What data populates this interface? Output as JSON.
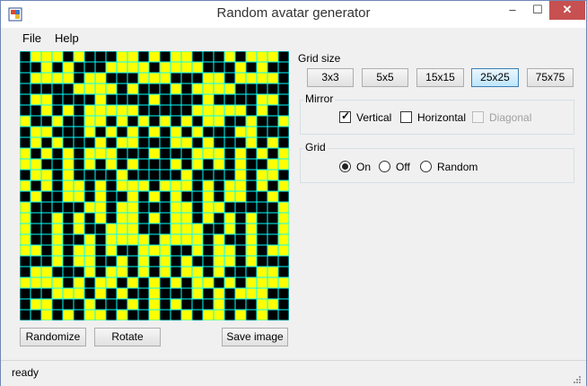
{
  "window": {
    "title": "Random avatar generator",
    "minimize_glyph": "–",
    "maximize_glyph": "☐",
    "close_glyph": "✕"
  },
  "menu": {
    "file": "File",
    "help": "Help"
  },
  "colors": {
    "foreground": "#000000",
    "background": "#ffff00",
    "gridline": "#00ffff"
  },
  "grid_size": {
    "label": "Grid size",
    "options": [
      "3x3",
      "5x5",
      "15x15",
      "25x25",
      "75x75"
    ],
    "selected": "25x25"
  },
  "mirror": {
    "label": "Mirror",
    "vertical": {
      "label": "Vertical",
      "checked": true
    },
    "horizontal": {
      "label": "Horizontal",
      "checked": false
    },
    "diagonal": {
      "label": "Diagonal",
      "checked": false,
      "disabled": true
    }
  },
  "grid": {
    "label": "Grid",
    "options": [
      "On",
      "Off",
      "Random"
    ],
    "selected": "On"
  },
  "buttons": {
    "randomize": "Randomize",
    "rotate": "Rotate",
    "save": "Save image"
  },
  "status": "ready",
  "avatar": {
    "size": 25,
    "rows": [
      "1000101110010100111010001",
      "1101011100001000011101011",
      "1000010011100011100100001",
      "1111100001011101000011111",
      "1001111011110111101111001",
      "1101010000011111000001011",
      "0110110010101010100110110",
      "1001110101010101011100111",
      "1010111010011100101110101",
      "0101010001110111000101010",
      "0011010101011101010101100",
      "1001011110111110111101001",
      "0101001010001000101001010",
      "1011001011010101101001101",
      "0111110010011100100111110",
      "0110101010010100101010110",
      "0110101100011100011010110",
      "0110110100001000010110110",
      "0010100101100011010010100",
      "1110100110101010110010111",
      "1001110100101010010111001",
      "0000101001010101001010000",
      "1110001010110111010100011",
      "1001110111010101110111001",
      "1101010010110110100101011"
    ]
  }
}
